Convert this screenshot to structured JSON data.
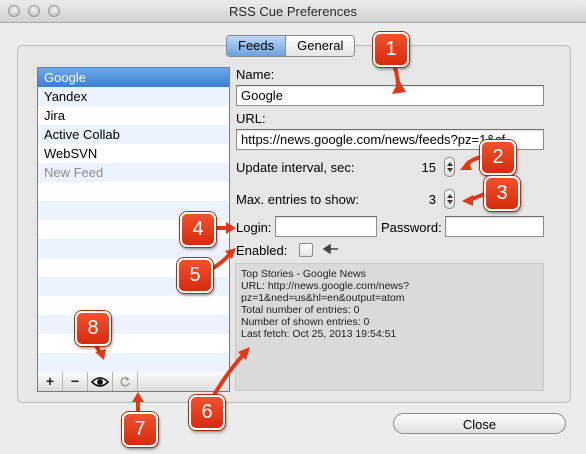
{
  "window": {
    "title": "RSS Cue Preferences"
  },
  "tabs": [
    {
      "label": "Feeds"
    },
    {
      "label": "General"
    }
  ],
  "feeds": {
    "items": [
      {
        "label": "Google",
        "selected": true
      },
      {
        "label": "Yandex"
      },
      {
        "label": "Jira"
      },
      {
        "label": "Active Collab"
      },
      {
        "label": "WebSVN"
      },
      {
        "label": "New Feed",
        "placeholder": true
      }
    ],
    "toolbar": {
      "add": "+",
      "remove": "−",
      "preview_icon": "eye-icon",
      "refresh_icon": "refresh-icon"
    }
  },
  "form": {
    "name_label": "Name:",
    "name_value": "Google",
    "url_label": "URL:",
    "url_value": "https://news.google.com/news/feeds?pz=1&cf",
    "interval_label": "Update interval, sec:",
    "interval_value": "15",
    "max_label": "Max. entries to show:",
    "max_value": "3",
    "login_label": "Login:",
    "login_value": "",
    "password_label": "Password:",
    "password_value": "",
    "enabled_label": "Enabled:",
    "enabled_checked": false
  },
  "info": {
    "text": "Top Stories - Google News\nURL: http://news.google.com/news?\npz=1&ned=us&hl=en&output=atom\nTotal number of entries: 0\nNumber of shown entries: 0\nLast fetch: Oct 25, 2013 19:54:51"
  },
  "close_button": "Close",
  "callouts": [
    "1",
    "2",
    "3",
    "4",
    "5",
    "6",
    "7",
    "8"
  ],
  "colors": {
    "callout": "#e0391a",
    "selection": "#3b7fd4"
  }
}
